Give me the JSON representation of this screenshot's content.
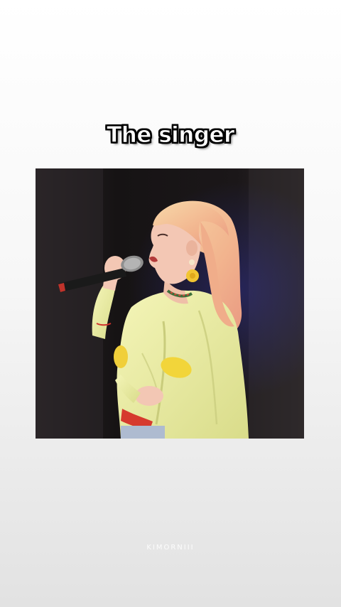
{
  "caption": "The singer",
  "watermark": "KIMORNIII",
  "photo": {
    "subject": "singer-with-microphone",
    "colors": {
      "background": "#1d1a1c",
      "curtain": "#2b2629",
      "hair": "#f0b58c",
      "skin": "#f3c7b4",
      "jacket": "#eef0a0",
      "mic": "#1a1a1a"
    }
  }
}
